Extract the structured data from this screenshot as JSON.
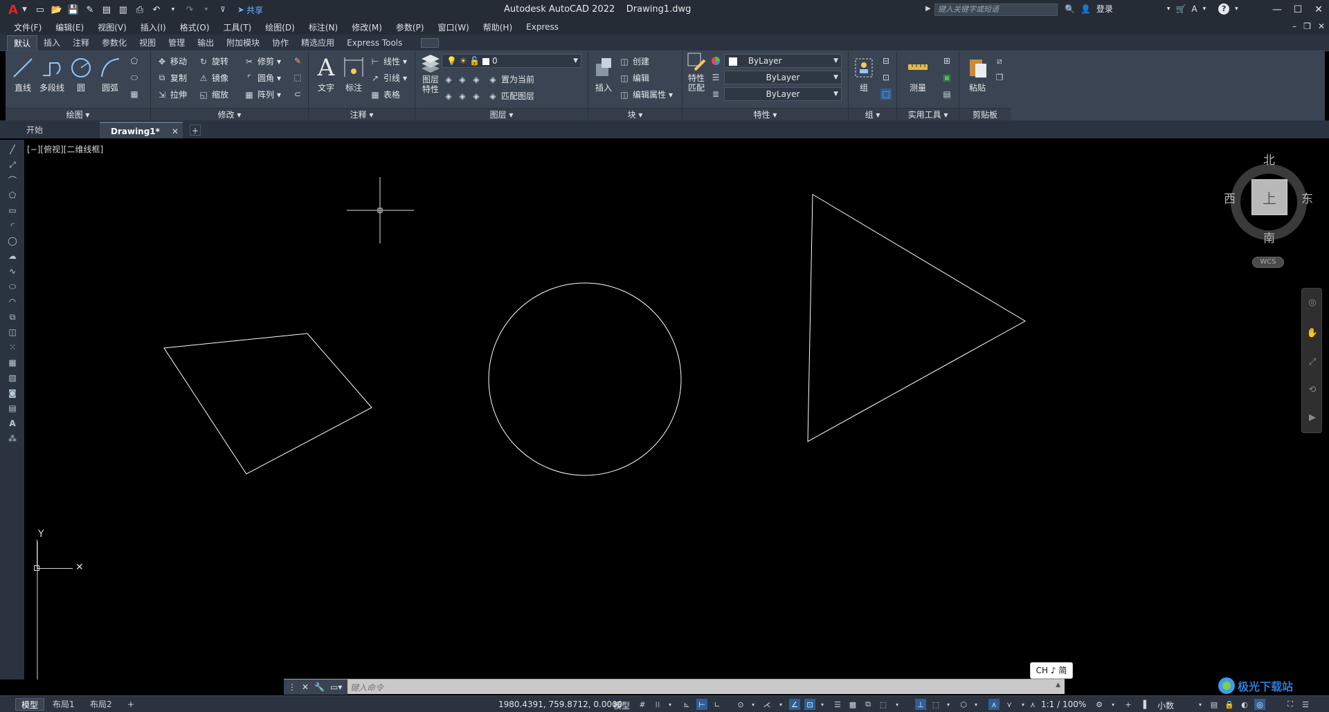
{
  "title_bar": {
    "logo": "A",
    "share_label": "共享",
    "title": "Autodesk AutoCAD 2022    Drawing1.dwg",
    "search_placeholder": "键入关键字或短语",
    "login_label": "登录",
    "help_label": "?"
  },
  "menu": {
    "items": [
      "文件(F)",
      "编辑(E)",
      "视图(V)",
      "插入(I)",
      "格式(O)",
      "工具(T)",
      "绘图(D)",
      "标注(N)",
      "修改(M)",
      "参数(P)",
      "窗口(W)",
      "帮助(H)",
      "Express"
    ]
  },
  "ribbon_tabs": [
    "默认",
    "插入",
    "注释",
    "参数化",
    "视图",
    "管理",
    "输出",
    "附加模块",
    "协作",
    "精选应用",
    "Express Tools"
  ],
  "ribbon": {
    "draw": {
      "title": "绘图",
      "line": "直线",
      "polyline": "多段线",
      "circle": "圆",
      "arc": "圆弧"
    },
    "modify": {
      "title": "修改",
      "move": "移动",
      "rotate": "旋转",
      "trim": "修剪",
      "copy": "复制",
      "mirror": "镜像",
      "fillet": "圆角",
      "stretch": "拉伸",
      "scale": "缩放",
      "array": "阵列"
    },
    "annotation": {
      "title": "注释",
      "text": "文字",
      "dimension": "标注",
      "linear": "线性",
      "leader": "引线",
      "table": "表格"
    },
    "layers": {
      "title": "图层",
      "layer_props": "图层\n特性",
      "layer_value": "0",
      "set_current": "置为当前",
      "match_layer": "匹配图层"
    },
    "block": {
      "title": "块",
      "insert": "插入",
      "create": "创建",
      "edit": "编辑",
      "edit_attr": "编辑属性"
    },
    "properties": {
      "title": "特性",
      "match": "特性\n匹配",
      "color": "ByLayer",
      "linetype": "ByLayer",
      "lineweight": "ByLayer"
    },
    "groups": {
      "title": "组",
      "group": "组"
    },
    "utilities": {
      "title": "实用工具",
      "measure": "测量"
    },
    "clipboard": {
      "title": "剪贴板",
      "paste": "粘贴"
    }
  },
  "doc_tabs": {
    "start": "开始",
    "active": "Drawing1*",
    "close": "✕",
    "plus": "+"
  },
  "viewport": {
    "label": "[−][俯视][二维线框]",
    "ucs_y": "Y",
    "ucs_x": "✕"
  },
  "viewcube": {
    "north": "北",
    "south": "南",
    "east": "东",
    "west": "西",
    "face": "上",
    "wcs": "WCS"
  },
  "command_line": {
    "placeholder": "键入命令"
  },
  "ime": {
    "label": "CH ♪ 简"
  },
  "status": {
    "layouts": [
      "模型",
      "布局1",
      "布局2"
    ],
    "plus": "+",
    "coords": "1980.4391, 759.8712, 0.0000",
    "model": "模型",
    "scale": "1:1 / 100%",
    "units": "小数"
  },
  "watermark": {
    "label": "极光下载站"
  }
}
